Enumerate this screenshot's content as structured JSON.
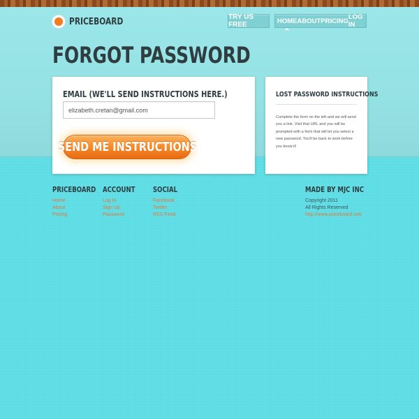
{
  "header": {
    "logo_text": "PRICEBOARD",
    "try_label": "TRY US FREE",
    "nav": [
      {
        "label": "HOME",
        "active": true
      },
      {
        "label": "ABOUT",
        "active": false
      },
      {
        "label": "PRICING",
        "active": false
      },
      {
        "label": "LOG IN",
        "active": false
      }
    ]
  },
  "page": {
    "title": "FORGOT PASSWORD"
  },
  "form": {
    "email_label": "EMAIL (WE'LL SEND INSTRUCTIONS HERE.)",
    "email_value": "elizabeth.cretan@gmail.com",
    "submit_label": "SEND ME INSTRUCTIONS"
  },
  "sidebar": {
    "title": "LOST PASSWORD INSTRUCTIONS",
    "text": "Complete the form on the left and we will send you a link. Visit that URL and you will be prompted with a form that will let you select a new password. You'll be back to work before you know it!"
  },
  "footer": {
    "priceboard": {
      "heading": "PRICEBOARD",
      "links": [
        "Home",
        "About",
        "Pricing"
      ]
    },
    "account": {
      "heading": "ACCOUNT",
      "links": [
        "Log In",
        "Sign Up",
        "Password"
      ]
    },
    "social": {
      "heading": "SOCIAL",
      "links": [
        "Facebook",
        "Twitter",
        "RSS Feed"
      ]
    },
    "made_by": {
      "heading": "MADE BY MJC INC",
      "copyright": "Copyright 2011",
      "rights": "All Rights Reserved",
      "url": "http://www.priceboard.net/"
    }
  },
  "colors": {
    "accent": "#f47b20",
    "link": "#e8753a",
    "background": "#5fdee6",
    "heading": "#2f3d40"
  }
}
